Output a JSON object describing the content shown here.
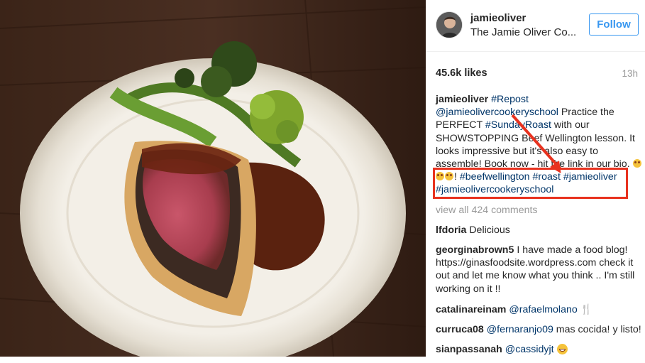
{
  "post": {
    "photo_alt": "Beef Wellington with broccoli and gravy",
    "username": "jamieoliver",
    "fullname": "The Jamie Oliver Co...",
    "follow_label": "Follow",
    "likes": "45.6k likes",
    "time": "13h"
  },
  "caption": {
    "user": "jamieoliver",
    "repost": "#Repost",
    "mention": "@jamieolivercookeryschool",
    "text1": " Practice the PERFECT ",
    "tag_sunday": "#SundayRoast",
    "text2": " with our SHOWSTOPPING Beef Wellington lesson. It looks impressive but it's also easy to assemble! Book now - hit the link in our bio.",
    "text3": "! ",
    "tag_beef": "#beefwellington",
    "tag_roast": "#roast",
    "tag_jamie": "#jamieoliver",
    "tag_school": "#jamieolivercookeryschool"
  },
  "view_all": "view all 424 comments",
  "comments": [
    {
      "user": "lfdoria",
      "text": "Delicious"
    },
    {
      "user": "georginabrown5",
      "text": "I have made a food blog! https://ginasfoodsite.wordpress.com check it out and let me know what you think .. I'm still working on it !!"
    },
    {
      "user": "catalinareinam",
      "mention": "@rafaelmolano"
    },
    {
      "user": "curruca08",
      "mention": "@fernaranjo09",
      "text": " mas cocida! y listo!"
    },
    {
      "user": "sianpassanah",
      "mention": "@cassidyjt"
    }
  ],
  "colors": {
    "accent": "#3897f0",
    "link": "#003569",
    "highlight": "#e8321f"
  },
  "icons": [
    "fork-knife-icon",
    "grin-emoji-icon",
    "smile-emoji-icon"
  ]
}
